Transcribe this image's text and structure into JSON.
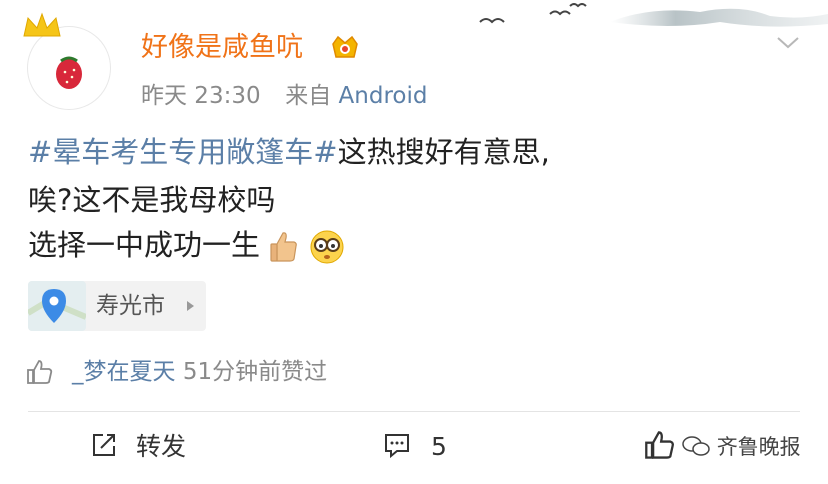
{
  "post": {
    "user_name": "好像是咸鱼吭",
    "time": "昨天 23:30",
    "source_prefix": "来自",
    "source": "Android",
    "hashtag": "#晕车考生专用敞篷车#",
    "line1_rest": "这热搜好有意思,",
    "line2": "唉?这不是我母校吗",
    "line3": "选择一中成功一生"
  },
  "location": {
    "label": "寿光市"
  },
  "likes": {
    "liker": "_梦在夏天",
    "text": "51分钟前赞过"
  },
  "actions": {
    "repost_label": "转发",
    "comment_count": "5"
  },
  "watermark": "齐鲁晚报",
  "icons": [
    "crown-icon",
    "vip-badge-icon",
    "chevron-down-icon",
    "map-pin-icon",
    "chevron-right-icon",
    "thumbs-up-icon",
    "repost-icon",
    "comment-icon",
    "like-icon",
    "wechat-icon",
    "thumbs-up-emoji",
    "nerd-face-emoji"
  ],
  "colors": {
    "username": "#f07318",
    "link": "#5b7fa7",
    "meta": "#8a8a8a"
  }
}
